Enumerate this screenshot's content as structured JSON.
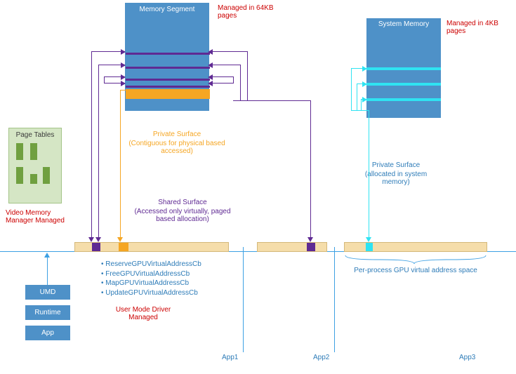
{
  "memory_segment": {
    "title": "Memory Segment",
    "managed_label": "Managed in 64KB pages"
  },
  "system_memory": {
    "title": "System Memory",
    "managed_label": "Managed in 4KB pages"
  },
  "page_tables": {
    "title": "Page Tables",
    "manager_label": "Video Memory Manager Managed"
  },
  "private_surface_mem": {
    "title": "Private Surface",
    "subtitle": "(Contiguous for physical based accessed)"
  },
  "shared_surface": {
    "title": "Shared Surface",
    "subtitle": "(Accessed only virtually, paged based allocation)"
  },
  "private_surface_sys": {
    "title": "Private Surface",
    "subtitle": "(allocated in system memory)"
  },
  "stack": {
    "umd": "UMD",
    "runtime": "Runtime",
    "app": "App"
  },
  "api_list": {
    "items": [
      "ReserveGPUVirtualAddressCb",
      "FreeGPUVirtualAddressCb",
      "MapGPUVirtualAddressCb",
      "UpdateGPUVirtualAddressCb"
    ],
    "managed_label": "User Mode Driver Managed"
  },
  "per_process_label": "Per-process GPU virtual address space",
  "apps": {
    "app1": "App1",
    "app2": "App2",
    "app3": "App3"
  }
}
